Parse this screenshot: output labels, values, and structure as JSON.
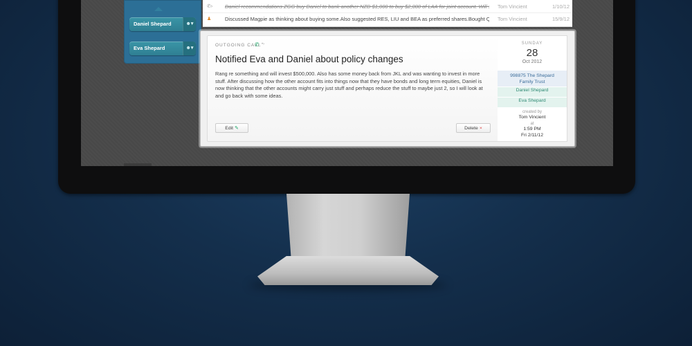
{
  "activity_list": {
    "rows": [
      {
        "icon": "phone-icon",
        "text": "Daniel recommendations ZGG buy Daniel to bank another NZD $1,000 to buy $2,000 of LAA for joint account. Will sell the D",
        "author": "Tom Vincient",
        "date": "1/10/12",
        "struck": true
      },
      {
        "icon": "people-icon",
        "text": "Discussed Magpie as thinking about buying some.Also suggested RES, LIU and BEA as preferred shares.Bought QWZ and I",
        "author": "Tom Vincient",
        "date": "15/9/12",
        "struck": false
      }
    ]
  },
  "sidebar": {
    "contacts": [
      {
        "name": "Daniel Shepard",
        "icon": "person-icon"
      },
      {
        "name": "Eva Shepard",
        "icon": "person-icon"
      }
    ]
  },
  "card": {
    "call_type": "OUTGOING CALL",
    "title": "Notified Eva and Daniel about policy changes",
    "body": "Rang re something and will invest $500,000. Also has some money back from JKL and was wanting to invest in more stuff.  After discussing how the other account fits into things now that they have bonds and long term equities, Daniel is now thinking that the other accounts might carry just stuff and perhaps reduce the stuff to maybe just 2, so I will look at and go back with some ideas.",
    "edit_label": "Edit",
    "delete_label": "Delete"
  },
  "side": {
    "weekday": "SUNDAY",
    "day": "28",
    "month_year": "Oct 2012",
    "trust_line1": "998875 The Shepard",
    "trust_line2": "Family Trust",
    "contact1": "Daniel Shepard",
    "contact2": "Eva Shepard",
    "created_by_label": "created by",
    "created_by": "Tom Vincient",
    "at_label": "at",
    "time": "1:59 PM",
    "date": "Fri 2/11/12"
  },
  "colors": {
    "accent_teal": "#2f8a74",
    "call_green": "#1fa86a",
    "sidebar_blue": "#2c6f96"
  }
}
